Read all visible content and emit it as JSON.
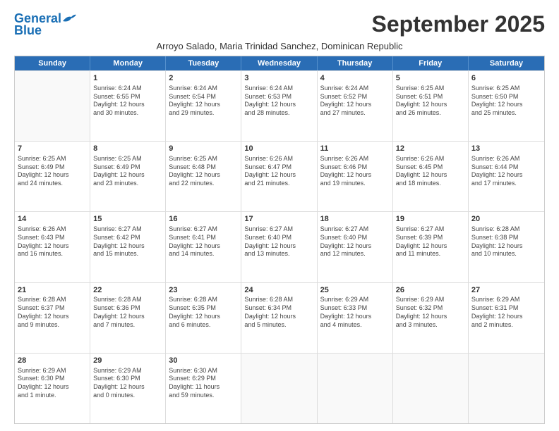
{
  "header": {
    "logo_general": "General",
    "logo_blue": "Blue",
    "month_title": "September 2025",
    "subtitle": "Arroyo Salado, Maria Trinidad Sanchez, Dominican Republic"
  },
  "days_of_week": [
    "Sunday",
    "Monday",
    "Tuesday",
    "Wednesday",
    "Thursday",
    "Friday",
    "Saturday"
  ],
  "weeks": [
    [
      {
        "day": "",
        "empty": true
      },
      {
        "day": "1",
        "sunrise": "6:24 AM",
        "sunset": "6:55 PM",
        "daylight": "12 hours and 30 minutes."
      },
      {
        "day": "2",
        "sunrise": "6:24 AM",
        "sunset": "6:54 PM",
        "daylight": "12 hours and 29 minutes."
      },
      {
        "day": "3",
        "sunrise": "6:24 AM",
        "sunset": "6:53 PM",
        "daylight": "12 hours and 28 minutes."
      },
      {
        "day": "4",
        "sunrise": "6:24 AM",
        "sunset": "6:52 PM",
        "daylight": "12 hours and 27 minutes."
      },
      {
        "day": "5",
        "sunrise": "6:25 AM",
        "sunset": "6:51 PM",
        "daylight": "12 hours and 26 minutes."
      },
      {
        "day": "6",
        "sunrise": "6:25 AM",
        "sunset": "6:50 PM",
        "daylight": "12 hours and 25 minutes."
      }
    ],
    [
      {
        "day": "7",
        "sunrise": "6:25 AM",
        "sunset": "6:49 PM",
        "daylight": "12 hours and 24 minutes."
      },
      {
        "day": "8",
        "sunrise": "6:25 AM",
        "sunset": "6:49 PM",
        "daylight": "12 hours and 23 minutes."
      },
      {
        "day": "9",
        "sunrise": "6:25 AM",
        "sunset": "6:48 PM",
        "daylight": "12 hours and 22 minutes."
      },
      {
        "day": "10",
        "sunrise": "6:26 AM",
        "sunset": "6:47 PM",
        "daylight": "12 hours and 21 minutes."
      },
      {
        "day": "11",
        "sunrise": "6:26 AM",
        "sunset": "6:46 PM",
        "daylight": "12 hours and 19 minutes."
      },
      {
        "day": "12",
        "sunrise": "6:26 AM",
        "sunset": "6:45 PM",
        "daylight": "12 hours and 18 minutes."
      },
      {
        "day": "13",
        "sunrise": "6:26 AM",
        "sunset": "6:44 PM",
        "daylight": "12 hours and 17 minutes."
      }
    ],
    [
      {
        "day": "14",
        "sunrise": "6:26 AM",
        "sunset": "6:43 PM",
        "daylight": "12 hours and 16 minutes."
      },
      {
        "day": "15",
        "sunrise": "6:27 AM",
        "sunset": "6:42 PM",
        "daylight": "12 hours and 15 minutes."
      },
      {
        "day": "16",
        "sunrise": "6:27 AM",
        "sunset": "6:41 PM",
        "daylight": "12 hours and 14 minutes."
      },
      {
        "day": "17",
        "sunrise": "6:27 AM",
        "sunset": "6:40 PM",
        "daylight": "12 hours and 13 minutes."
      },
      {
        "day": "18",
        "sunrise": "6:27 AM",
        "sunset": "6:40 PM",
        "daylight": "12 hours and 12 minutes."
      },
      {
        "day": "19",
        "sunrise": "6:27 AM",
        "sunset": "6:39 PM",
        "daylight": "12 hours and 11 minutes."
      },
      {
        "day": "20",
        "sunrise": "6:28 AM",
        "sunset": "6:38 PM",
        "daylight": "12 hours and 10 minutes."
      }
    ],
    [
      {
        "day": "21",
        "sunrise": "6:28 AM",
        "sunset": "6:37 PM",
        "daylight": "12 hours and 9 minutes."
      },
      {
        "day": "22",
        "sunrise": "6:28 AM",
        "sunset": "6:36 PM",
        "daylight": "12 hours and 7 minutes."
      },
      {
        "day": "23",
        "sunrise": "6:28 AM",
        "sunset": "6:35 PM",
        "daylight": "12 hours and 6 minutes."
      },
      {
        "day": "24",
        "sunrise": "6:28 AM",
        "sunset": "6:34 PM",
        "daylight": "12 hours and 5 minutes."
      },
      {
        "day": "25",
        "sunrise": "6:29 AM",
        "sunset": "6:33 PM",
        "daylight": "12 hours and 4 minutes."
      },
      {
        "day": "26",
        "sunrise": "6:29 AM",
        "sunset": "6:32 PM",
        "daylight": "12 hours and 3 minutes."
      },
      {
        "day": "27",
        "sunrise": "6:29 AM",
        "sunset": "6:31 PM",
        "daylight": "12 hours and 2 minutes."
      }
    ],
    [
      {
        "day": "28",
        "sunrise": "6:29 AM",
        "sunset": "6:30 PM",
        "daylight": "12 hours and 1 minute."
      },
      {
        "day": "29",
        "sunrise": "6:29 AM",
        "sunset": "6:30 PM",
        "daylight": "12 hours and 0 minutes."
      },
      {
        "day": "30",
        "sunrise": "6:30 AM",
        "sunset": "6:29 PM",
        "daylight": "11 hours and 59 minutes."
      },
      {
        "day": "",
        "empty": true
      },
      {
        "day": "",
        "empty": true
      },
      {
        "day": "",
        "empty": true
      },
      {
        "day": "",
        "empty": true
      }
    ]
  ]
}
